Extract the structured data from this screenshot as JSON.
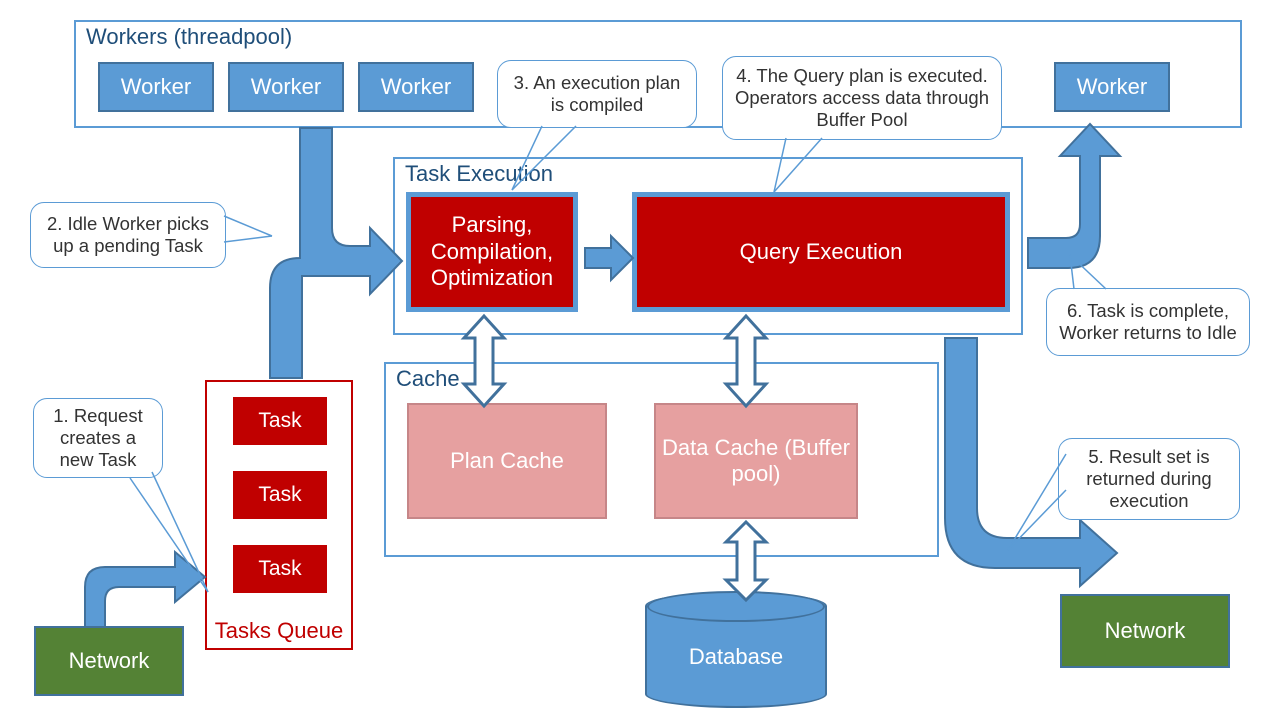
{
  "workers_panel": {
    "title": "Workers (threadpool)",
    "items": [
      "Worker",
      "Worker",
      "Worker",
      "Worker"
    ]
  },
  "task_exec_panel": {
    "title": "Task Execution"
  },
  "cache_panel": {
    "title": "Cache"
  },
  "parsing_box": "Parsing, Compilation, Optimization",
  "query_exec_box": "Query Execution",
  "plan_cache": "Plan Cache",
  "data_cache": "Data Cache (Buffer pool)",
  "queue": {
    "title": "Tasks Queue",
    "items": [
      "Task",
      "Task",
      "Task"
    ]
  },
  "network": {
    "left": "Network",
    "right": "Network"
  },
  "database": "Database",
  "callouts": {
    "c1": "1. Request creates a new Task",
    "c2": "2. Idle Worker picks up a pending Task",
    "c3": "3. An execution plan is compiled",
    "c4": "4. The Query plan is executed. Operators access data through Buffer Pool",
    "c5": "5. Result set is returned during execution",
    "c6": "6. Task is complete, Worker returns to Idle"
  },
  "colors": {
    "blue": "#5b9bd5",
    "blue_border": "#41719c",
    "red": "#c00000",
    "pink": "#e6a0a0",
    "green": "#548235",
    "title": "#1f4e79"
  }
}
